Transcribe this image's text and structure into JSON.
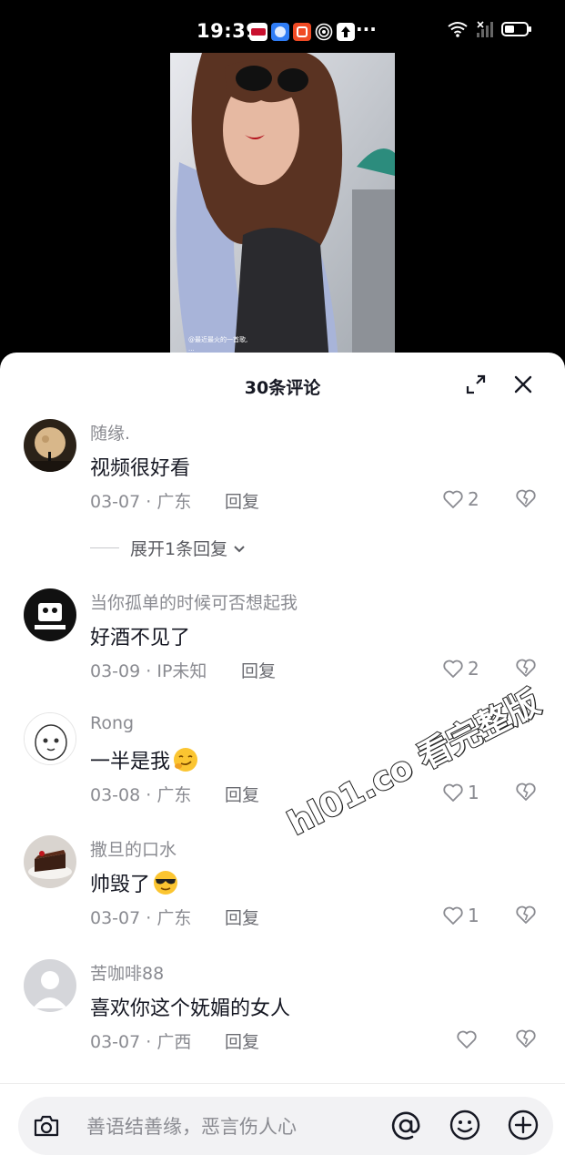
{
  "status_bar": {
    "time": "19:39",
    "more": "···",
    "icons": [
      "huawei-app-icon",
      "blue-app-icon",
      "red-app-icon",
      "hotspot-icon",
      "upload-icon",
      "wifi-icon",
      "signal-icon",
      "battery-icon"
    ]
  },
  "video": {
    "caption_line1": "@最近最火的一首歌,",
    "caption_line2": "..."
  },
  "comments_panel": {
    "title": "30条评论",
    "reply_label": "回复",
    "comments": [
      {
        "user": "随缘.",
        "text": "视频很好看",
        "date": "03-07",
        "location": "广东",
        "likes": "2",
        "avatar": "moon-night-avatar"
      },
      {
        "user": "当你孤单的时候可否想起我",
        "text": "好酒不见了",
        "date": "03-09",
        "location": "IP未知",
        "likes": "2",
        "avatar": "panda-meme-avatar"
      },
      {
        "user": "Rong",
        "text": "一半是我",
        "date": "03-08",
        "location": "广东",
        "likes": "1",
        "avatar": "cartoon-face-avatar",
        "emoji": "smirk-emoji"
      },
      {
        "user": "撒旦的口水",
        "text": "帅毁了",
        "date": "03-07",
        "location": "广东",
        "likes": "1",
        "avatar": "cake-avatar",
        "emoji": "sunglasses-emoji"
      },
      {
        "user": "苦咖啡88",
        "text": "喜欢你这个妩媚的女人",
        "date": "03-07",
        "location": "广西",
        "likes": "",
        "avatar": "default-user-avatar"
      }
    ],
    "expand_replies": "展开1条回复"
  },
  "input_bar": {
    "placeholder": "善语结善缘，恶言伤人心"
  },
  "watermark": "hl01.co 看完整版",
  "colors": {
    "text_primary": "#161823",
    "text_secondary": "#8a8b91",
    "background": "#ffffff"
  }
}
